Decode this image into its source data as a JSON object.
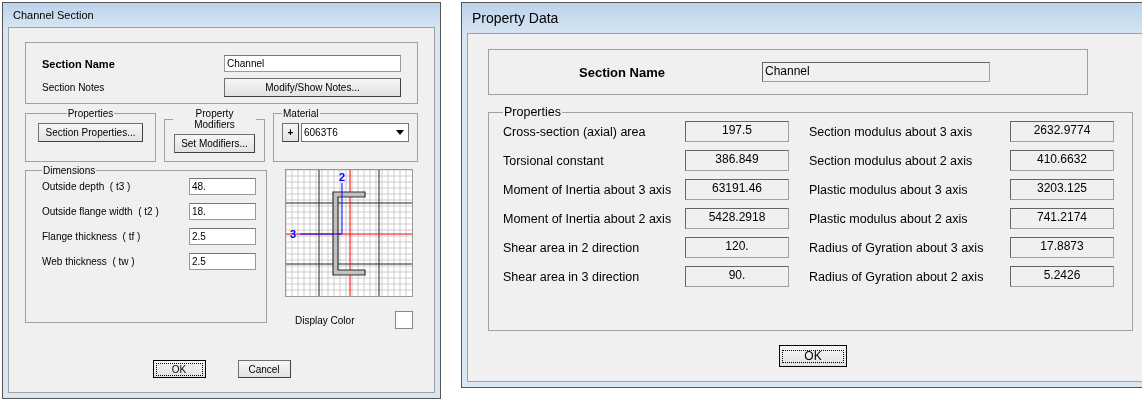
{
  "channel_section": {
    "title": "Channel Section",
    "section_name": {
      "label": "Section Name",
      "value": "Channel"
    },
    "section_notes": {
      "label": "Section Notes",
      "button": "Modify/Show Notes..."
    },
    "properties": {
      "title": "Properties",
      "button": "Section Properties..."
    },
    "property_modifiers": {
      "title": "Property Modifiers",
      "button": "Set Modifiers..."
    },
    "material": {
      "title": "Material",
      "add_button": "+",
      "value": "6063T6"
    },
    "dimensions": {
      "title": "Dimensions",
      "rows": [
        {
          "label": "Outside depth  ( t3 )",
          "value": "48."
        },
        {
          "label": "Outside flange width  ( t2 )",
          "value": "18."
        },
        {
          "label": "Flange thickness  ( tf )",
          "value": "2.5"
        },
        {
          "label": "Web thickness  ( tw )",
          "value": "2.5"
        }
      ]
    },
    "diagram": {
      "axis_2": "2",
      "axis_3": "3"
    },
    "display_color": {
      "label": "Display Color"
    },
    "buttons": [
      {
        "label": "OK",
        "focused": true
      },
      {
        "label": "Cancel",
        "focused": false
      }
    ]
  },
  "property_data": {
    "title": "Property Data",
    "section_name": {
      "label": "Section Name",
      "value": "Channel"
    },
    "properties": {
      "title": "Properties",
      "rows": [
        {
          "label": "Cross-section (axial) area",
          "value": "197.5",
          "label_2": "Section modulus about 3 axis",
          "value_2": "2632.9774"
        },
        {
          "label": "Torsional constant",
          "value": "386.849",
          "label_2": "Section modulus about 2 axis",
          "value_2": "410.6632"
        },
        {
          "label": "Moment of Inertia about 3 axis",
          "value": "63191.46",
          "label_2": "Plastic modulus about 3 axis",
          "value_2": "3203.125"
        },
        {
          "label": "Moment of Inertia about 2 axis",
          "value": "5428.2918",
          "label_2": "Plastic modulus about 2 axis",
          "value_2": "741.2174"
        },
        {
          "label": "Shear area in 2 direction",
          "value": "120.",
          "label_2": "Radius of Gyration about 3 axis",
          "value_2": "17.8873"
        },
        {
          "label": "Shear area in 3 direction",
          "value": "90.",
          "label_2": "Radius of Gyration about 2 axis",
          "value_2": "5.2426"
        }
      ]
    },
    "buttons": [
      {
        "label": "OK",
        "focused": true
      }
    ]
  }
}
